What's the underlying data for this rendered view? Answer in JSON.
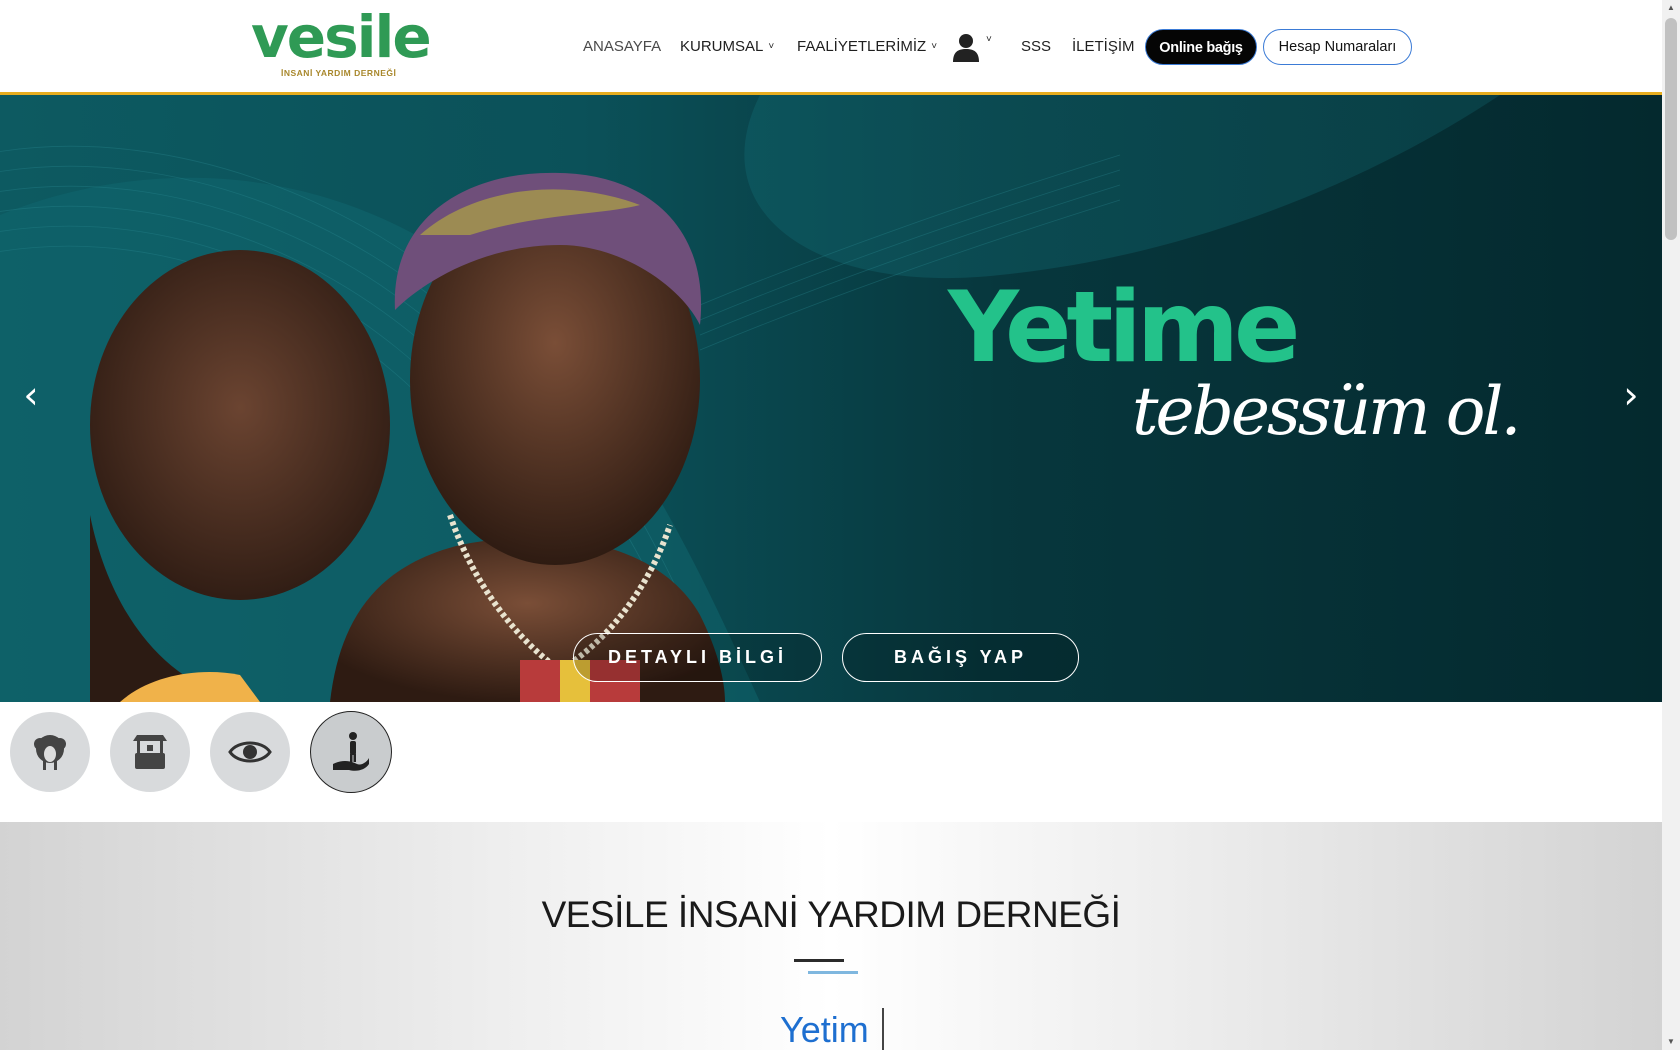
{
  "brand": {
    "name": "vesile",
    "tagline": "İNSANİ YARDIM DERNEĞİ",
    "primary_color": "#2f9a55",
    "accent_color": "#e7ad1f"
  },
  "nav": {
    "items": [
      {
        "label": "ANASAYFA",
        "active": true
      },
      {
        "label": "KURUMSAL",
        "dropdown": true
      },
      {
        "label": "FAALİYETLERİMİZ",
        "dropdown": true
      },
      {
        "label": "SSS"
      },
      {
        "label": "İLETİŞİM"
      }
    ],
    "user_icon": "user-icon",
    "online_button": "Online bağış",
    "accounts_button": "Hesap Numaraları"
  },
  "hero": {
    "title": "Yetime",
    "script": "tebessüm ol.",
    "prev_icon": "chevron-left-icon",
    "next_icon": "chevron-right-icon",
    "buttons": [
      "DETAYLI BİLGİ",
      "BAĞIŞ YAP"
    ]
  },
  "categories": [
    {
      "icon": "sheep-icon",
      "active": false
    },
    {
      "icon": "water-well-icon",
      "active": false
    },
    {
      "icon": "eye-icon",
      "active": false
    },
    {
      "icon": "child-hand-icon",
      "active": true
    }
  ],
  "about": {
    "title": "VESİLE İNSANİ YARDIM DERNEĞİ",
    "typed_word": "Yetim"
  }
}
